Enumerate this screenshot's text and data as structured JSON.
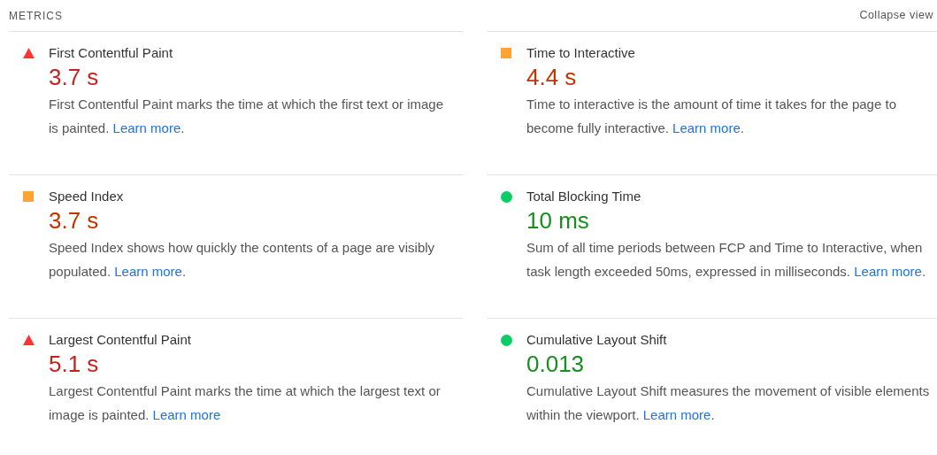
{
  "header": {
    "title": "METRICS",
    "toggle": "Collapse view"
  },
  "metrics": [
    {
      "kind": "fail",
      "title": "First Contentful Paint",
      "value": "3.7 s",
      "description": "First Contentful Paint marks the time at which the first text or image is painted.",
      "link": "Learn more",
      "suffix": "."
    },
    {
      "kind": "average",
      "title": "Time to Interactive",
      "value": "4.4 s",
      "description": "Time to interactive is the amount of time it takes for the page to become fully interactive.",
      "link": "Learn more",
      "suffix": "."
    },
    {
      "kind": "average",
      "title": "Speed Index",
      "value": "3.7 s",
      "description": "Speed Index shows how quickly the contents of a page are visibly populated.",
      "link": "Learn more",
      "suffix": "."
    },
    {
      "kind": "pass",
      "title": "Total Blocking Time",
      "value": "10 ms",
      "description": "Sum of all time periods between FCP and Time to Interactive, when task length exceeded 50ms, expressed in milliseconds.",
      "link": "Learn more",
      "suffix": "."
    },
    {
      "kind": "fail",
      "title": "Largest Contentful Paint",
      "value": "5.1 s",
      "description": "Largest Contentful Paint marks the time at which the largest text or image is painted.",
      "link": "Learn more"
    },
    {
      "kind": "pass",
      "title": "Cumulative Layout Shift",
      "value": "0.013",
      "description": "Cumulative Layout Shift measures the movement of visible elements within the viewport.",
      "link": "Learn more",
      "suffix": "."
    }
  ]
}
